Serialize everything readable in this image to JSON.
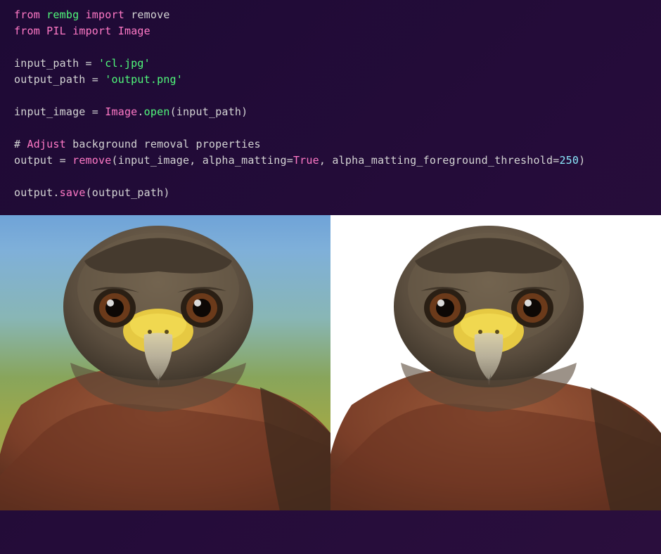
{
  "code": {
    "l1": {
      "from": "from",
      "rembg": "rembg",
      "import": "import",
      "remove": "remove"
    },
    "l2": {
      "from": "from",
      "pil": "PIL",
      "import": "import",
      "image": "Image"
    },
    "l4": {
      "var": "input_path",
      "eq": " = ",
      "str": "'cl.jpg'"
    },
    "l5": {
      "var": "output_path",
      "eq": " = ",
      "str": "'output.png'"
    },
    "l7": {
      "var": "input_image",
      "eq": " = ",
      "cls": "Image",
      "dot": ".",
      "fn": "open",
      "args": "(input_path)"
    },
    "l9": {
      "hash": "# ",
      "highlight": "Adjust",
      "rest": " background removal properties"
    },
    "l10": {
      "var": "output",
      "eq": " = ",
      "fn": "remove",
      "open": "(input_image, alpha_matting=",
      "true": "True",
      "mid": ", alpha_matting_foreground_threshold=",
      "num": "250",
      "close": ")"
    },
    "l12": {
      "obj": "output",
      "dot": ".",
      "fn": "save",
      "args": "(output_path)"
    }
  },
  "images": {
    "left_desc": "Bird with blurred background",
    "right_desc": "Bird with background removed"
  }
}
